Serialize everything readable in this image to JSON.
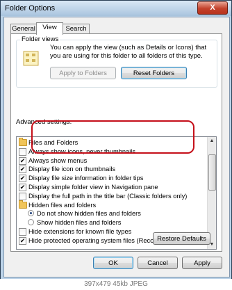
{
  "window": {
    "title": "Folder Options",
    "close_glyph": "X"
  },
  "tabs": [
    {
      "label": "General",
      "active": false
    },
    {
      "label": "View",
      "active": true
    },
    {
      "label": "Search",
      "active": false
    }
  ],
  "folder_views": {
    "label": "Folder views",
    "description": "You can apply the view (such as Details or Icons) that you are using for this folder to all folders of this type.",
    "apply_button": "Apply to Folders",
    "apply_disabled": true,
    "reset_button": "Reset Folders"
  },
  "advanced": {
    "label": "Advanced settings:",
    "items": [
      {
        "kind": "folder",
        "label": "Files and Folders",
        "checked": null
      },
      {
        "kind": "checkbox",
        "label": "Always show icons, never thumbnails",
        "checked": false
      },
      {
        "kind": "checkbox",
        "label": "Always show menus",
        "checked": true
      },
      {
        "kind": "checkbox",
        "label": "Display file icon on thumbnails",
        "checked": true
      },
      {
        "kind": "checkbox",
        "label": "Display file size information in folder tips",
        "checked": true
      },
      {
        "kind": "checkbox",
        "label": "Display simple folder view in Navigation pane",
        "checked": true
      },
      {
        "kind": "checkbox",
        "label": "Display the full path in the title bar (Classic folders only)",
        "checked": false
      },
      {
        "kind": "folder",
        "label": "Hidden files and folders",
        "checked": null
      },
      {
        "kind": "radio",
        "label": "Do not show hidden files and folders",
        "checked": true
      },
      {
        "kind": "radio",
        "label": "Show hidden files and folders",
        "checked": false
      },
      {
        "kind": "checkbox",
        "label": "Hide extensions for known file types",
        "checked": false
      },
      {
        "kind": "checkbox",
        "label": "Hide protected operating system files (Recommended)",
        "checked": true
      }
    ],
    "check_glyph": "✔",
    "highlight_color": "#c5101a"
  },
  "restore_button": "Restore Defaults",
  "footer": {
    "ok": "OK",
    "cancel": "Cancel",
    "apply": "Apply"
  },
  "caption": "397x479 45kb JPEG"
}
